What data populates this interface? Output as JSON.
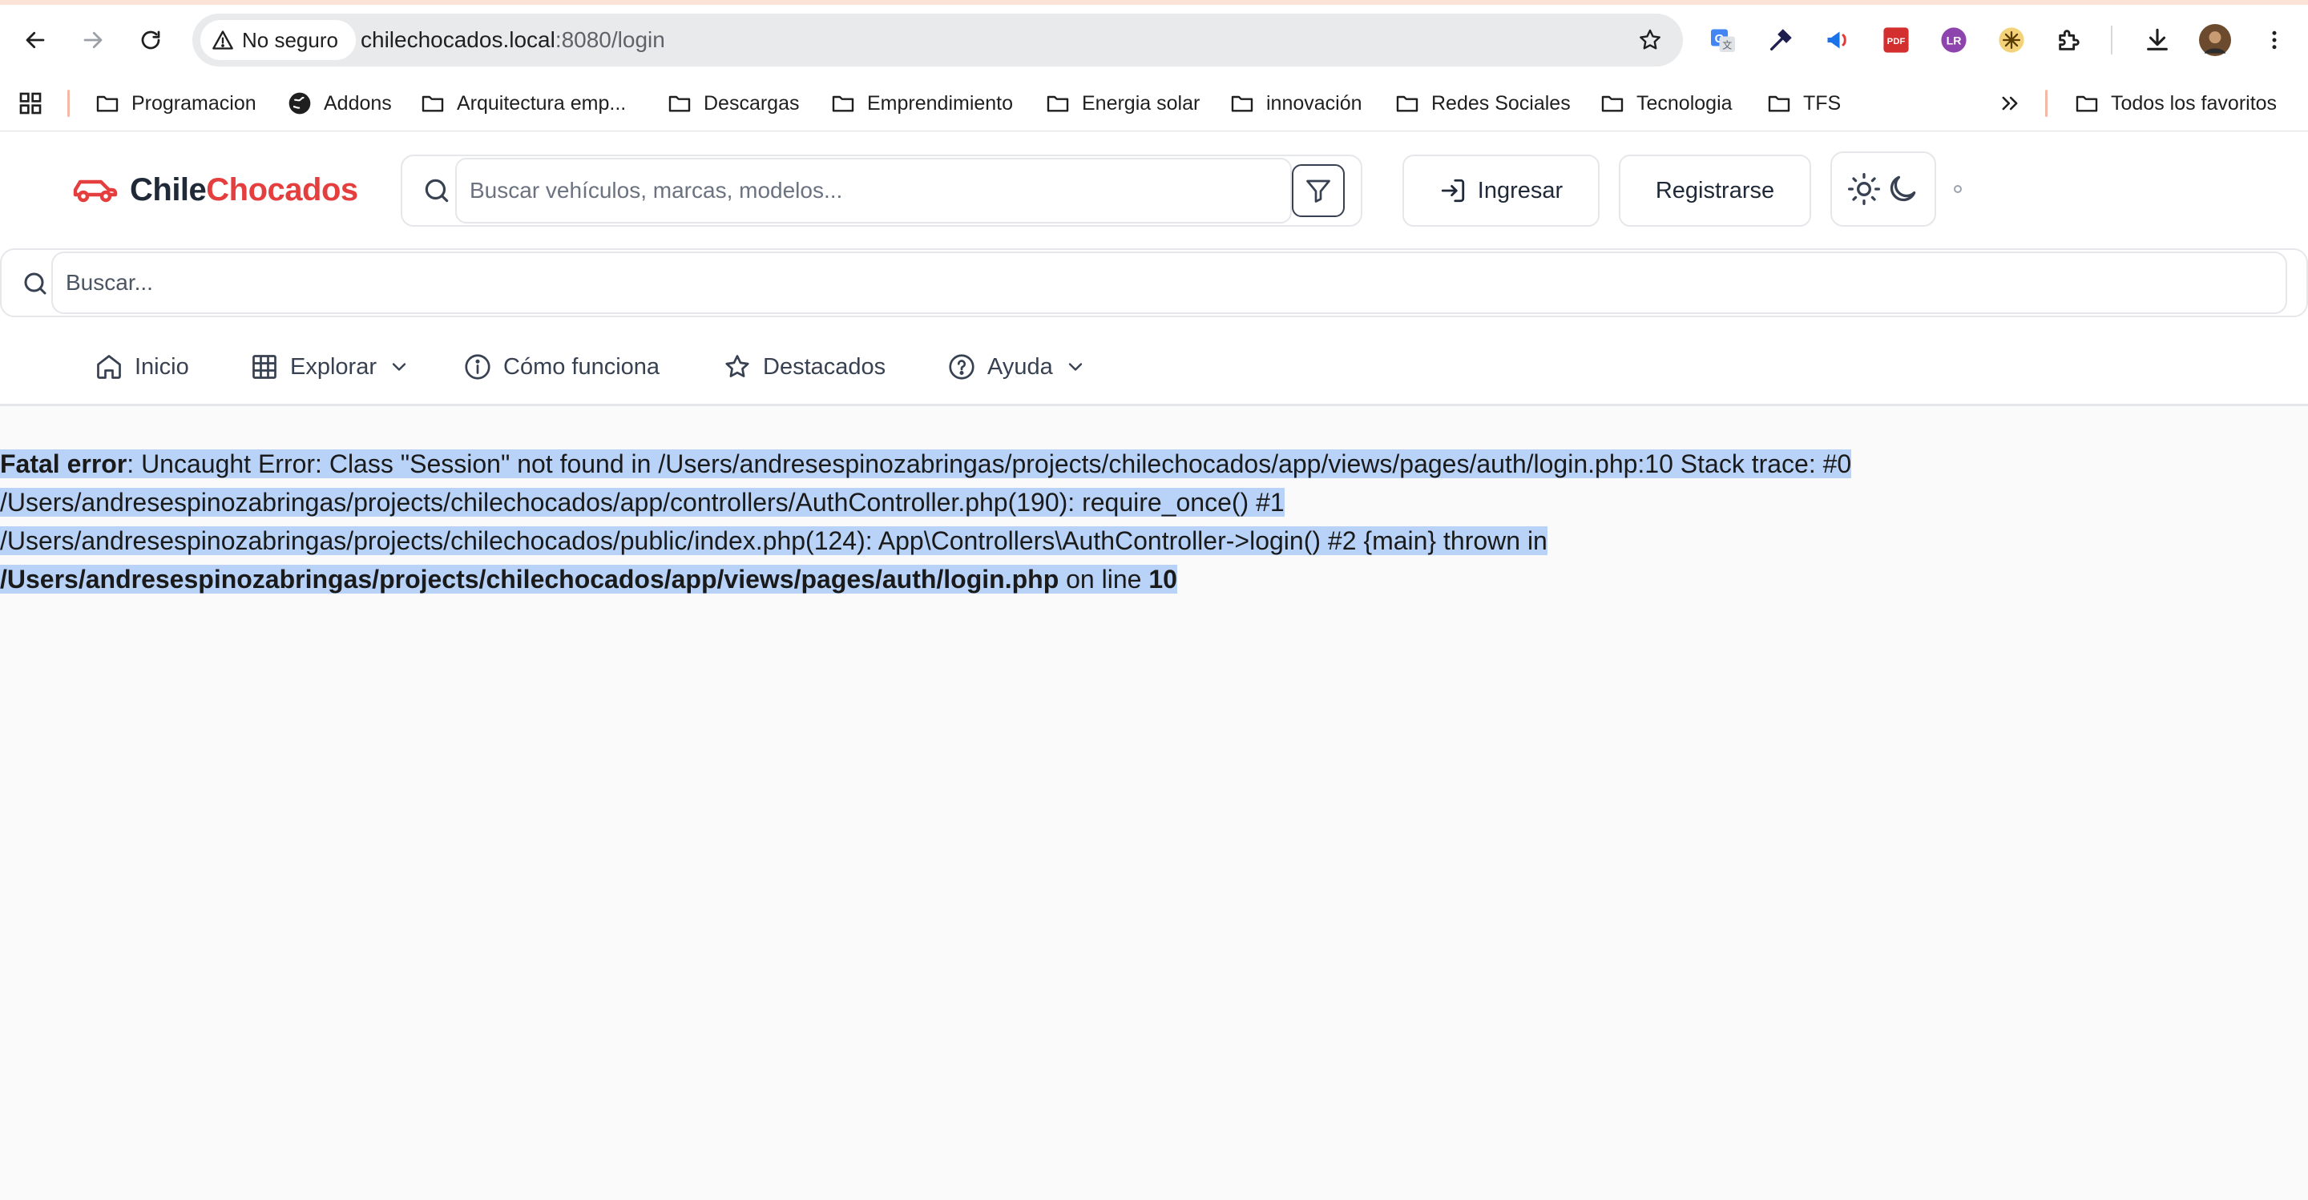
{
  "browser": {
    "security_label": "No seguro",
    "url_host": "chilechocados.local",
    "url_rest": ":8080/login",
    "extensions": [
      "translate-icon",
      "eyedropper-icon",
      "megaphone-icon",
      "pdf-icon",
      "profile-ext-icon",
      "sun-ext-icon",
      "puzzle-icon"
    ],
    "bookmarks": [
      {
        "label": "Programacion",
        "icon": "folder-icon"
      },
      {
        "label": "Addons",
        "icon": "globe-icon"
      },
      {
        "label": "Arquitectura emp...",
        "icon": "folder-icon"
      },
      {
        "label": "Descargas",
        "icon": "folder-icon"
      },
      {
        "label": "Emprendimiento",
        "icon": "folder-icon"
      },
      {
        "label": "Energia solar",
        "icon": "folder-icon"
      },
      {
        "label": "innovación",
        "icon": "folder-icon"
      },
      {
        "label": "Redes Sociales",
        "icon": "folder-icon"
      },
      {
        "label": "Tecnologia",
        "icon": "folder-icon"
      },
      {
        "label": "TFS",
        "icon": "folder-icon"
      }
    ],
    "all_bookmarks_label": "Todos los favoritos"
  },
  "site": {
    "logo_part1": "Chile",
    "logo_part2": "Chocados",
    "brand_color": "#e53e3e",
    "search_placeholder": "Buscar vehículos, marcas, modelos...",
    "login_label": "Ingresar",
    "register_label": "Registrarse",
    "global_search_placeholder": "Buscar...",
    "nav": {
      "home": "Inicio",
      "explore": "Explorar",
      "how": "Cómo funciona",
      "featured": "Destacados",
      "help": "Ayuda"
    }
  },
  "error": {
    "label": "Fatal error",
    "line1": ": Uncaught Error: Class \"Session\" not found in /Users/andresespinozabringas/projects/chilechocados/app/views/pages/auth/login.php:10 Stack trace: #0",
    "line2": "/Users/andresespinozabringas/projects/chilechocados/app/controllers/AuthController.php(190): require_once() #1",
    "line3": "/Users/andresespinozabringas/projects/chilechocados/public/index.php(124): App\\Controllers\\AuthController->login() #2 {main} thrown in",
    "file": "/Users/andresespinozabringas/projects/chilechocados/app/views/pages/auth/login.php",
    "on_line_label": " on line ",
    "line_number": "10",
    "highlight_color": "#b9d3f8"
  }
}
